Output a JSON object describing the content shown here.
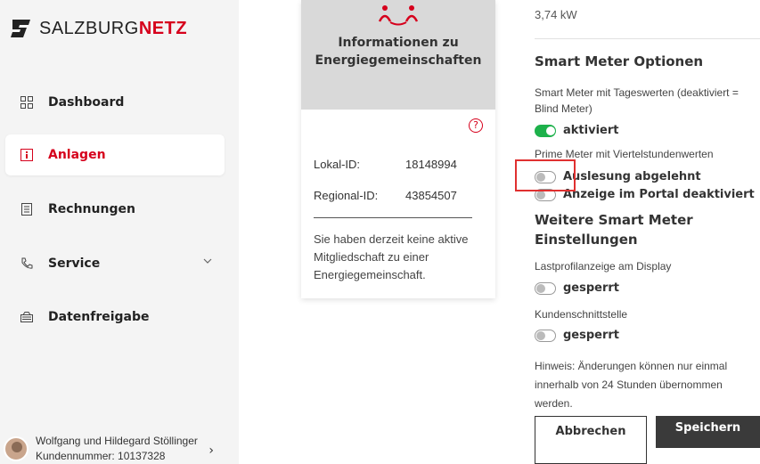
{
  "brand": {
    "name_light": "SALZBURG",
    "name_bold": "NETZ",
    "accent": "#d6001c"
  },
  "nav": [
    {
      "label": "Dashboard",
      "icon": "grid-icon",
      "active": false
    },
    {
      "label": "Anlagen",
      "icon": "meter-icon",
      "active": true
    },
    {
      "label": "Rechnungen",
      "icon": "invoice-icon",
      "active": false
    },
    {
      "label": "Service",
      "icon": "phone-icon",
      "active": false
    },
    {
      "label": "Datenfreigabe",
      "icon": "data-share-icon",
      "active": false
    }
  ],
  "user": {
    "name": "Wolfgang und Hildegard Stöllinger",
    "customer": "Kundennummer: 10137328"
  },
  "card": {
    "title": "Informationen zu Energiegemeinschaften",
    "local_label": "Lokal-ID:",
    "local_value": "18148994",
    "regional_label": "Regional-ID:",
    "regional_value": "43854507",
    "note": "Sie haben derzeit keine aktive Mitgliedschaft zu einer Energiegemeinschaft."
  },
  "settings": {
    "power": "3,74 kW",
    "section_title": "Smart Meter Optionen",
    "daily_label": "Smart Meter mit Tageswerten (deaktiviert = Blind Meter)",
    "daily_state": "aktiviert",
    "prime_label": "Prime Meter mit Viertelstundenwerten",
    "prime_state": "Auslesung abgelehnt",
    "portal_state": "Anzeige im Portal deaktiviert",
    "more_title": "Weitere Smart Meter Einstellungen",
    "display_label": "Lastprofilanzeige am Display",
    "display_state": "gesperrt",
    "interface_label": "Kundenschnittstelle",
    "interface_state": "gesperrt",
    "hint": "Hinweis: Änderungen können nur einmal innerhalb von 24 Stunden übernommen werden.",
    "cancel": "Abbrechen",
    "save": "Speichern"
  }
}
